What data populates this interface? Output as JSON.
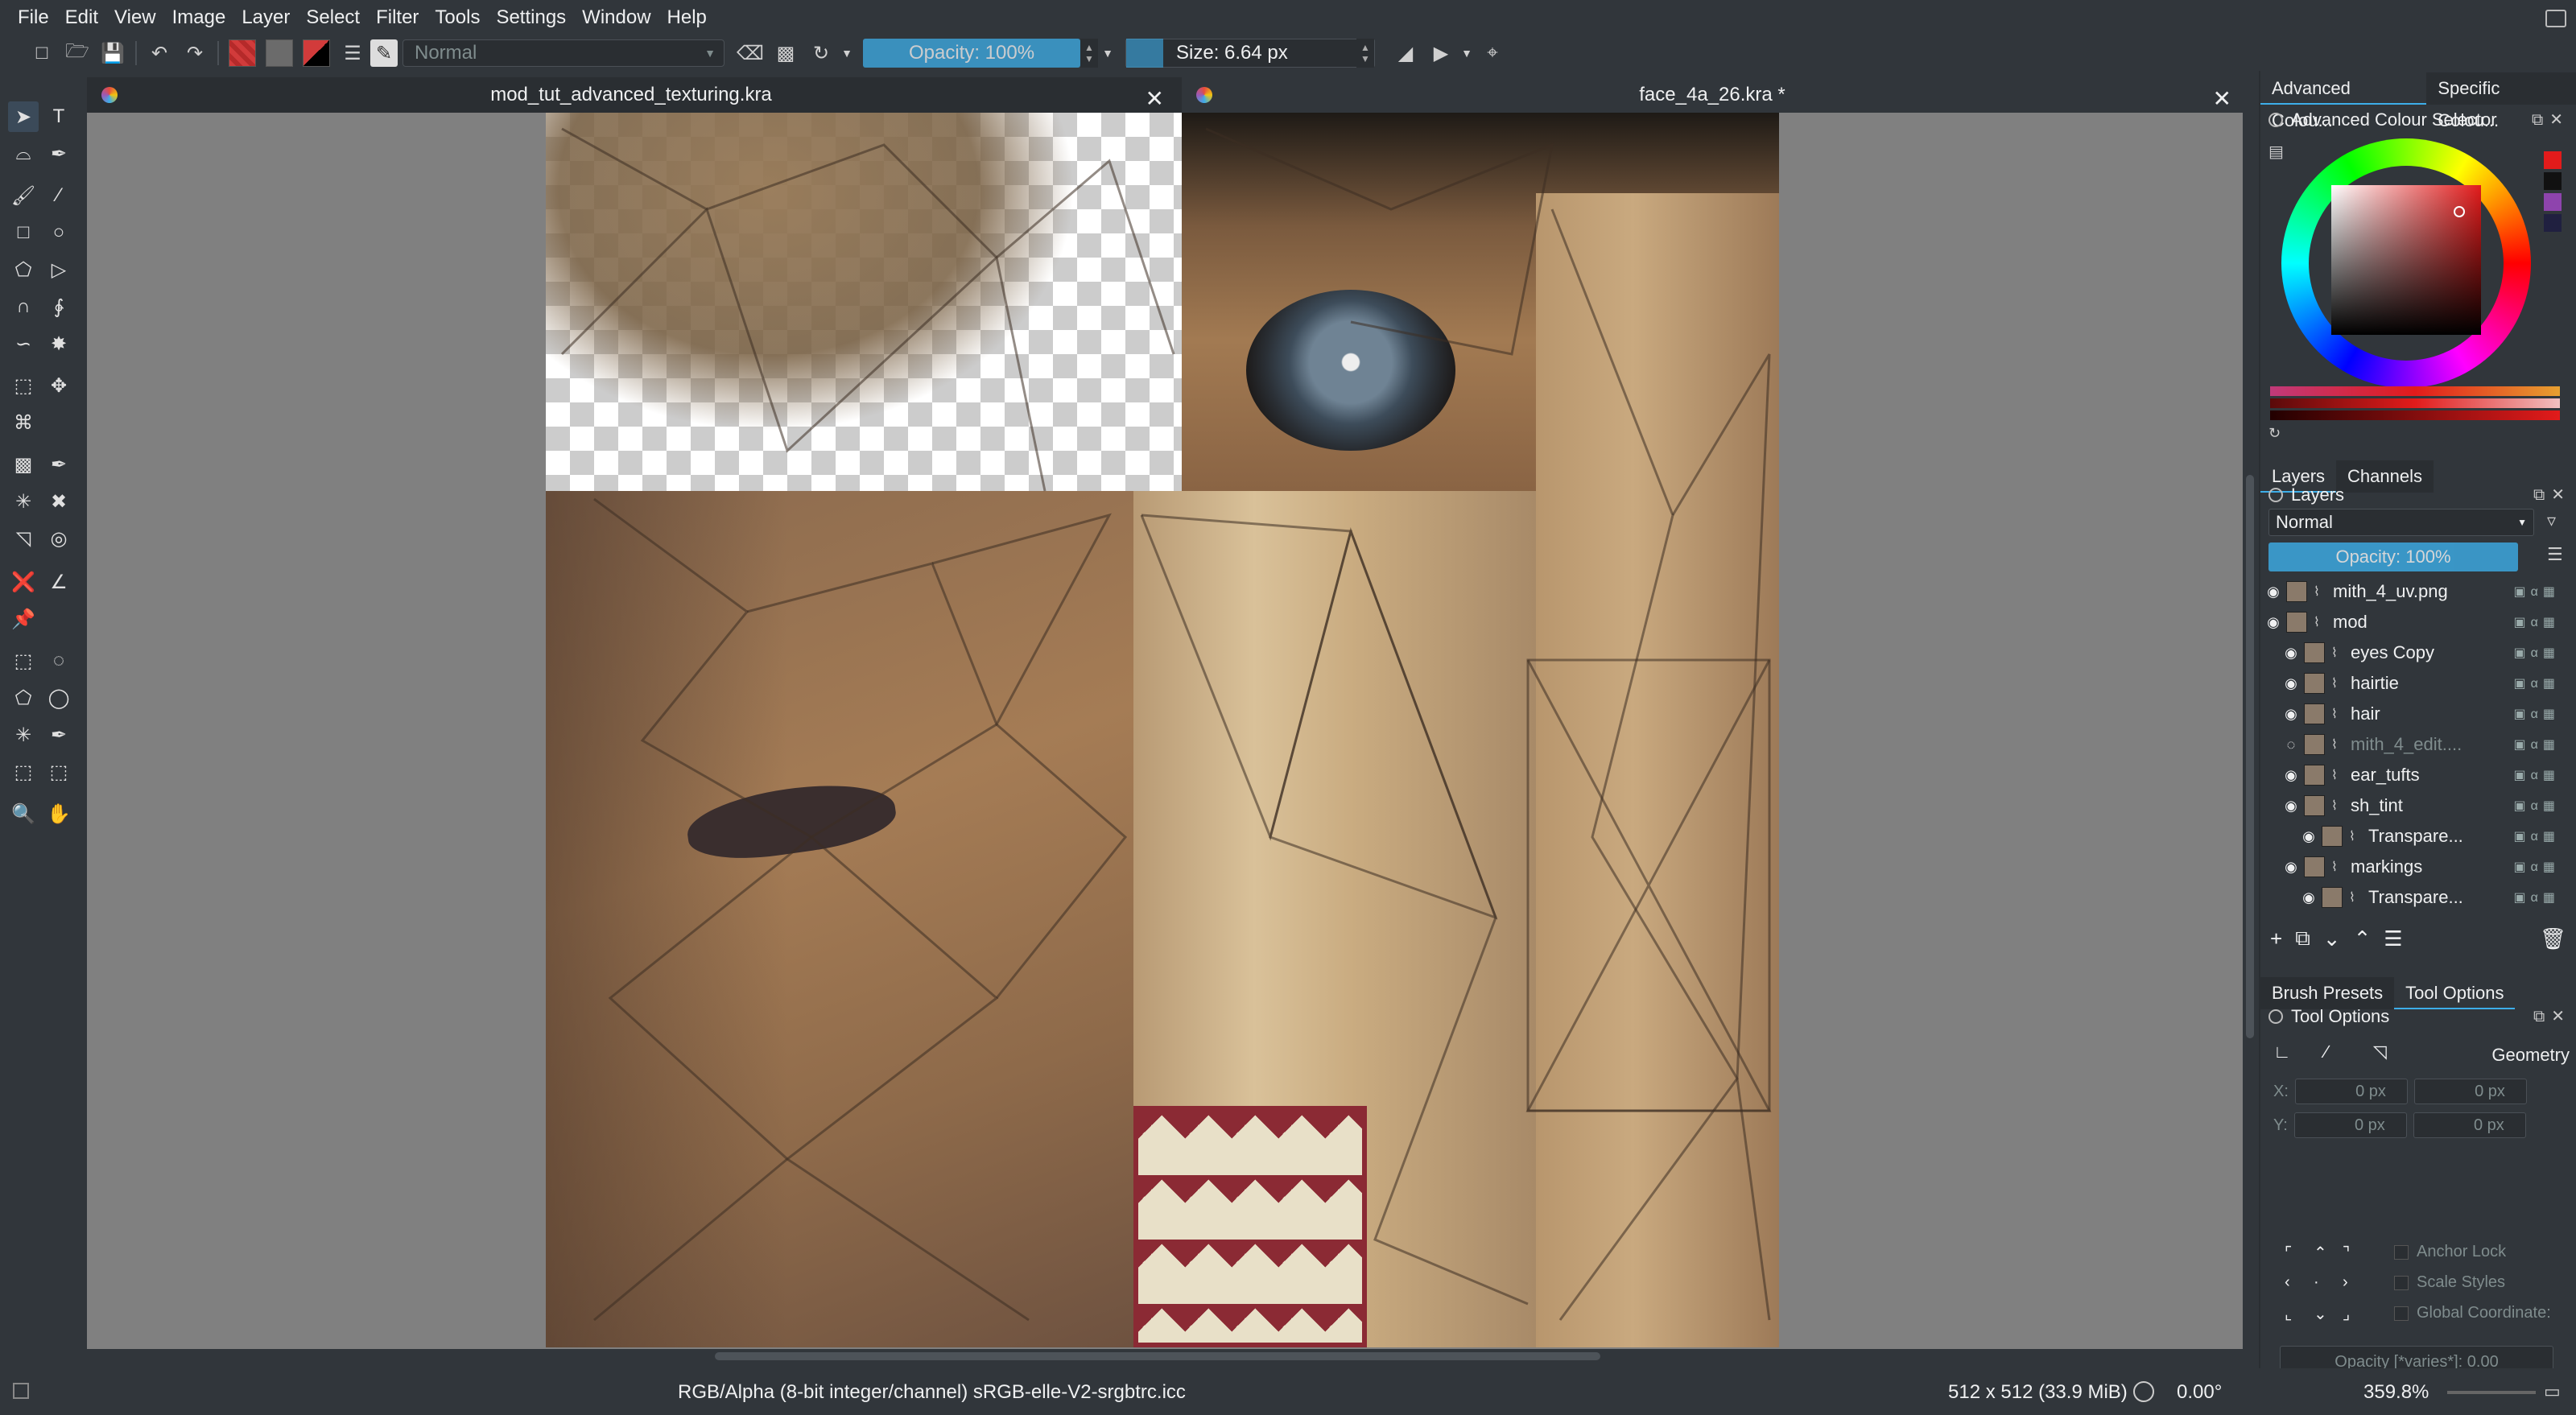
{
  "menu": [
    "File",
    "Edit",
    "View",
    "Image",
    "Layer",
    "Select",
    "Filter",
    "Tools",
    "Settings",
    "Window",
    "Help"
  ],
  "toolbar": {
    "blend_mode": "Normal",
    "opacity_label": "Opacity: 100%",
    "size_label": "Size: 6.64 px",
    "fg_color": "#d23b3b",
    "bg_color": "#000000"
  },
  "tabs": [
    {
      "title": "mod_tut_advanced_texturing.kra"
    },
    {
      "title": "face_4a_26.kra *"
    }
  ],
  "color_docker": {
    "tabs": [
      "Advanced Colou...",
      "Specific Colou..."
    ],
    "title": "Advanced Colour Selector",
    "selected_color": "#e21b1b"
  },
  "layers_docker": {
    "tabs": [
      "Layers",
      "Channels"
    ],
    "title": "Layers",
    "blend_mode": "Normal",
    "opacity_label": "Opacity:  100%",
    "layers": [
      {
        "name": "mith_4_uv.png",
        "indent": 0,
        "visible": true
      },
      {
        "name": "mod",
        "indent": 0,
        "visible": true
      },
      {
        "name": "eyes Copy",
        "indent": 1,
        "visible": true
      },
      {
        "name": "hairtie",
        "indent": 1,
        "visible": true
      },
      {
        "name": "hair",
        "indent": 1,
        "visible": true
      },
      {
        "name": "mith_4_edit....",
        "indent": 1,
        "visible": false
      },
      {
        "name": "ear_tufts",
        "indent": 1,
        "visible": true
      },
      {
        "name": "sh_tint",
        "indent": 1,
        "visible": true
      },
      {
        "name": "Transpare...",
        "indent": 2,
        "visible": true
      },
      {
        "name": "markings",
        "indent": 1,
        "visible": true
      },
      {
        "name": "Transpare...",
        "indent": 2,
        "visible": true
      }
    ]
  },
  "tool_options_docker": {
    "tabs": [
      "Brush Presets",
      "Tool Options"
    ],
    "title": "Tool Options",
    "geometry_label": "Geometry",
    "x_label": "X:",
    "y_label": "Y:",
    "x_value_1": "0 px",
    "x_value_2": "0 px",
    "y_value_1": "0 px",
    "y_value_2": "0 px",
    "anchor_lock": "Anchor Lock",
    "scale_styles": "Scale Styles",
    "global_coords": "Global Coordinate:",
    "opacity_varies": "Opacity [*varies*]: 0.00"
  },
  "status": {
    "color_space": "RGB/Alpha (8-bit integer/channel)  sRGB-elle-V2-srgbtrc.icc",
    "image_size": "512 x 512 (33.9 MiB)",
    "rotation": "0.00°",
    "zoom": "359.8%"
  }
}
